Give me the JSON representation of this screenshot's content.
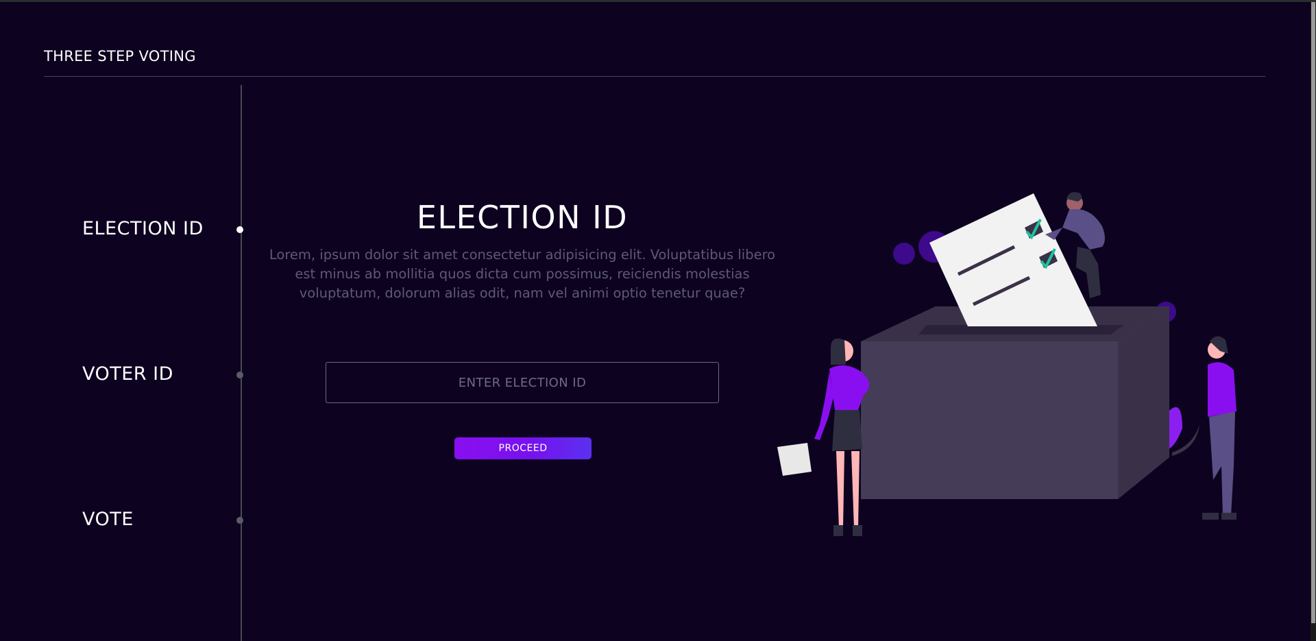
{
  "header": {
    "brand": "THREE STEP VOTING"
  },
  "steps": [
    {
      "label": "ELECTION ID",
      "active": true
    },
    {
      "label": "VOTER ID",
      "active": false
    },
    {
      "label": "VOTE",
      "active": false
    }
  ],
  "main": {
    "title": "ELECTION ID",
    "description": "Lorem, ipsum dolor sit amet consectetur adipisicing elit. Voluptatibus libero est minus ab mollitia quos dicta cum possimus, reiciendis molestias voluptatum, dolorum alias odit, nam vel animi optio tenetur quae?",
    "input_placeholder": "ENTER ELECTION ID",
    "input_value": "",
    "proceed_label": "PROCEED"
  },
  "colors": {
    "background": "#0d0320",
    "accent": "#7f14f0",
    "muted_text": "#5f5a72"
  },
  "illustration": {
    "name": "ballot-box-voting-illustration"
  }
}
